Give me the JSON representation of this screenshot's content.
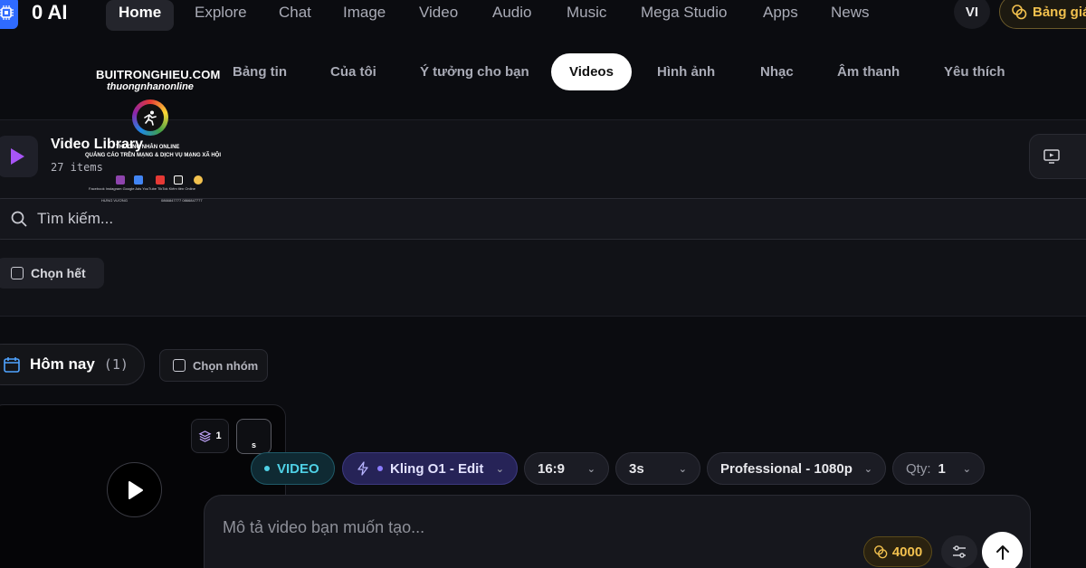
{
  "app": {
    "brand": "0 AI",
    "nav": [
      "Home",
      "Explore",
      "Chat",
      "Image",
      "Video",
      "Audio",
      "Music",
      "Mega Studio",
      "Apps",
      "News"
    ],
    "nav_active": "Home",
    "language": "VI",
    "pricing_label": "Bảng giá"
  },
  "subtabs": {
    "items": [
      "Bảng tin",
      "Của tôi",
      "Ý tưởng cho bạn",
      "Videos",
      "Hình ảnh",
      "Nhạc",
      "Âm thanh",
      "Yêu thích"
    ],
    "active": "Videos"
  },
  "watermark": {
    "site": "BUITRONGHIEU.COM",
    "handle": "thuongnhanonline",
    "line1": "THƯƠNG NHÂN ONLINE",
    "line2": "QUẢNG CÁO TRÊN MẠNG & DỊCH VỤ MẠNG XÃ HỘI",
    "social_labels": "Facebook   Instagram   Google Ads   YouTube   TikTok   Kiếm tiền Online",
    "footer_left": "HƯNG VƯƠNG",
    "footer_right": "0866847777     0866847777"
  },
  "library": {
    "title": "Video Library",
    "count": "27 items",
    "search_placeholder": "Tìm kiếm...",
    "select_all": "Chọn hết"
  },
  "group": {
    "label": "Hôm nay",
    "count": "(1)",
    "select_label": "Chọn nhóm"
  },
  "video_card": {
    "stack_count": "1",
    "duration_badge": "s"
  },
  "generator": {
    "mode": "VIDEO",
    "model": "Kling O1 - Edit",
    "aspect_ratio": "16:9",
    "duration": "3s",
    "quality": "Professional - 1080p",
    "qty_label": "Qty:",
    "qty_value": "1",
    "prompt_placeholder": "Mô tả video bạn muốn tạo...",
    "credits": "4000"
  },
  "colors": {
    "accent_video": "#4fd1e6",
    "accent_model": "#8b7cff",
    "gold": "#f2c14e",
    "play_purple": "#a855f7"
  },
  "icons": {
    "logo": "chip-icon",
    "pricing": "coins-icon",
    "library": "play-icon",
    "search": "search-icon",
    "group": "calendar-icon",
    "stack": "layers-icon",
    "model": "bolt-icon",
    "settings": "sliders-icon",
    "send": "arrow-up-icon"
  }
}
